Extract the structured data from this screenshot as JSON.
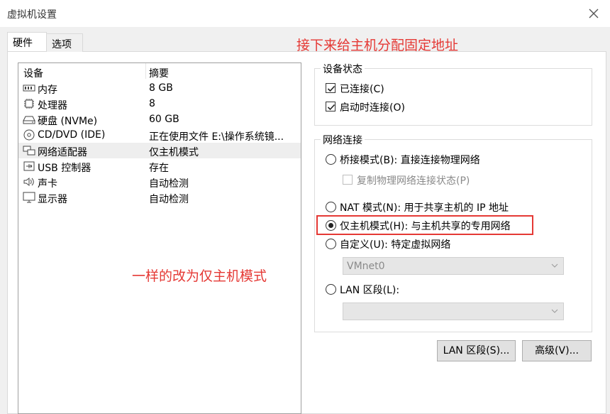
{
  "window": {
    "title": "虚拟机设置"
  },
  "tabs": [
    {
      "label": "硬件"
    },
    {
      "label": "选项"
    }
  ],
  "annotations": {
    "top": "接下来给主机分配固定地址",
    "middle": "一样的改为仅主机模式"
  },
  "devices": {
    "header": {
      "device": "设备",
      "summary": "摘要"
    },
    "rows": [
      {
        "icon": "memory-icon",
        "name": "内存",
        "summary": "8 GB"
      },
      {
        "icon": "processor-icon",
        "name": "处理器",
        "summary": "8"
      },
      {
        "icon": "hard-disk-icon",
        "name": "硬盘 (NVMe)",
        "summary": "60 GB"
      },
      {
        "icon": "cd-dvd-icon",
        "name": "CD/DVD (IDE)",
        "summary": "正在使用文件 E:\\操作系统镜..."
      },
      {
        "icon": "network-adapter-icon",
        "name": "网络适配器",
        "summary": "仅主机模式",
        "selected": true
      },
      {
        "icon": "usb-icon",
        "name": "USB 控制器",
        "summary": "存在"
      },
      {
        "icon": "sound-card-icon",
        "name": "声卡",
        "summary": "自动检测"
      },
      {
        "icon": "display-icon",
        "name": "显示器",
        "summary": "自动检测"
      }
    ]
  },
  "device_status": {
    "legend": "设备状态",
    "connected": "已连接(C)",
    "connect_at_power_on": "启动时连接(O)"
  },
  "network": {
    "legend": "网络连接",
    "bridged": "桥接模式(B): 直接连接物理网络",
    "replicate": "复制物理网络连接状态(P)",
    "nat": "NAT 模式(N): 用于共享主机的 IP 地址",
    "host_only": "仅主机模式(H): 与主机共享的专用网络",
    "custom": "自定义(U): 特定虚拟网络",
    "custom_value": "VMnet0",
    "lan_segment": "LAN 区段(L):",
    "lan_segment_value": ""
  },
  "buttons": {
    "lan_segments": "LAN 区段(S)...",
    "advanced": "高级(V)..."
  }
}
